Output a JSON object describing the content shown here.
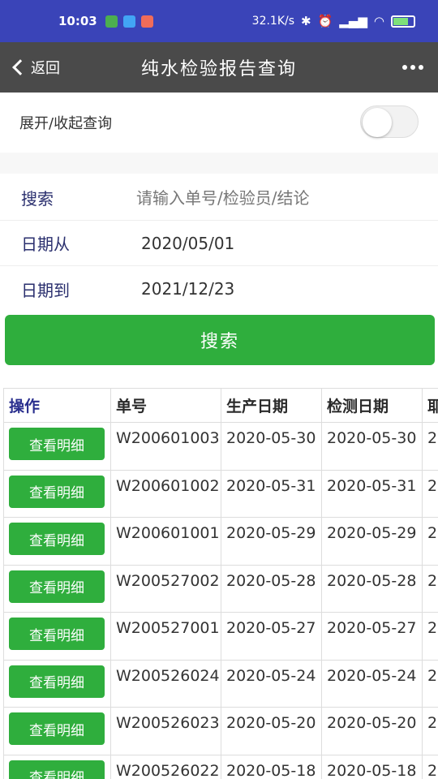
{
  "status_bar": {
    "time": "10:03",
    "net_speed": "32.1K/s",
    "icons": [
      "wechat-icon",
      "cloud-icon",
      "health-icon",
      "bluetooth-icon",
      "alarm-icon",
      "signal-icon",
      "wifi-icon",
      "battery-icon"
    ]
  },
  "nav": {
    "back_label": "返回",
    "title": "纯水检验报告查询"
  },
  "toggle": {
    "label": "展开/收起查询",
    "on": false
  },
  "form": {
    "search_label": "搜索",
    "search_placeholder": "请输入单号/检验员/结论",
    "date_from_label": "日期从",
    "date_from_value": "2020/05/01",
    "date_to_label": "日期到",
    "date_to_value": "2021/12/23"
  },
  "search_button": "搜索",
  "table": {
    "headers": [
      "操作",
      "单号",
      "生产日期",
      "检测日期",
      "耶"
    ],
    "rows": [
      {
        "action": "查看明细",
        "no": "W200601003",
        "prod_date": "2020-05-30",
        "test_date": "2020-05-30",
        "extra": "2"
      },
      {
        "action": "查看明细",
        "no": "W200601002",
        "prod_date": "2020-05-31",
        "test_date": "2020-05-31",
        "extra": "2"
      },
      {
        "action": "查看明细",
        "no": "W200601001",
        "prod_date": "2020-05-29",
        "test_date": "2020-05-29",
        "extra": "2"
      },
      {
        "action": "查看明细",
        "no": "W200527002",
        "prod_date": "2020-05-28",
        "test_date": "2020-05-28",
        "extra": "2"
      },
      {
        "action": "查看明细",
        "no": "W200527001",
        "prod_date": "2020-05-27",
        "test_date": "2020-05-27",
        "extra": "2"
      },
      {
        "action": "查看明细",
        "no": "W200526024",
        "prod_date": "2020-05-24",
        "test_date": "2020-05-24",
        "extra": "2"
      },
      {
        "action": "查看明细",
        "no": "W200526023",
        "prod_date": "2020-05-20",
        "test_date": "2020-05-20",
        "extra": "2"
      },
      {
        "action": "查看明细",
        "no": "W200526022",
        "prod_date": "2020-05-18",
        "test_date": "2020-05-18",
        "extra": "2"
      }
    ]
  },
  "colors": {
    "status_bar": "#3a44b8",
    "nav_bar": "#4a4a4a",
    "accent_green": "#2fae3d"
  }
}
